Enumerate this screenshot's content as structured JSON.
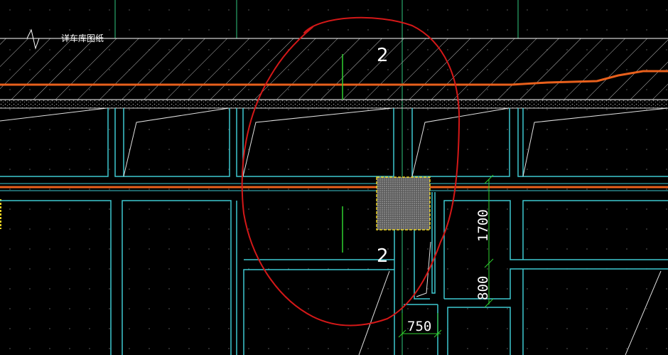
{
  "drawing": {
    "note_text": "详车库图纸",
    "section_mark_top": "2",
    "section_mark_bottom": "2",
    "dimension_vertical_1": "1700",
    "dimension_vertical_2": "800",
    "dimension_horizontal": "750"
  },
  "colors": {
    "background": "#000000",
    "beam_outline": "#3ec8d0",
    "grid_line": "#30c880",
    "pipe_orange": "#e8601c",
    "markup_red": "#d41818",
    "hatch": "#b8b8b8",
    "column_outline": "#e8d020",
    "dimension": "#30d030",
    "text": "#ffffff"
  }
}
